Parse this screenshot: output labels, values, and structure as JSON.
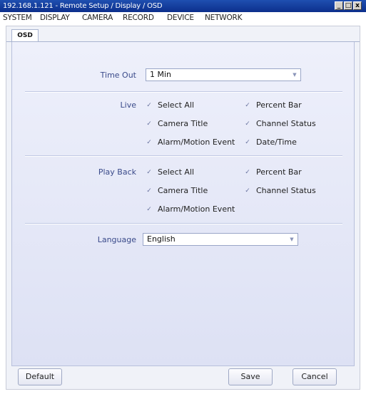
{
  "window": {
    "title": "192.168.1.121 - Remote Setup / Display / OSD",
    "minimize": "_",
    "maximize": "□",
    "close": "x"
  },
  "menu": [
    "SYSTEM",
    "DISPLAY",
    "CAMERA",
    "RECORD",
    "DEVICE",
    "NETWORK"
  ],
  "tab": {
    "label": "OSD"
  },
  "timeout": {
    "label": "Time Out",
    "value": "1 Min"
  },
  "live": {
    "label": "Live",
    "items": [
      {
        "label": "Select All",
        "checked": true
      },
      {
        "label": "Percent Bar",
        "checked": true
      },
      {
        "label": "Camera Title",
        "checked": true
      },
      {
        "label": "Channel Status",
        "checked": true
      },
      {
        "label": "Alarm/Motion Event",
        "checked": true
      },
      {
        "label": "Date/Time",
        "checked": true
      }
    ]
  },
  "playback": {
    "label": "Play Back",
    "items": [
      {
        "label": "Select All",
        "checked": true
      },
      {
        "label": "Percent Bar",
        "checked": true
      },
      {
        "label": "Camera Title",
        "checked": true
      },
      {
        "label": "Channel Status",
        "checked": true
      },
      {
        "label": "Alarm/Motion Event",
        "checked": true
      }
    ]
  },
  "language": {
    "label": "Language",
    "value": "English"
  },
  "buttons": {
    "default": "Default",
    "save": "Save",
    "cancel": "Cancel"
  },
  "check_glyph": "✓",
  "dropdown_glyph": "▼"
}
